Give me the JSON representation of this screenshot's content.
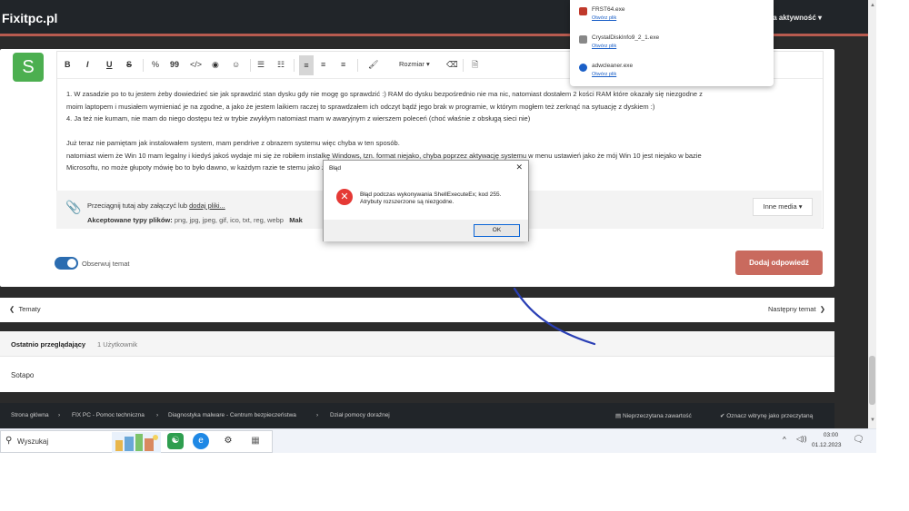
{
  "header": {
    "site_name": "Fixitpc.pl",
    "activity_link": "la aktywność ▾"
  },
  "editor": {
    "avatar_letter": "S",
    "toolbar": {
      "bold": "B",
      "italic": "I",
      "underline": "U",
      "strike": "S",
      "link": "%",
      "quote": "99",
      "code": "</>",
      "spoiler": "◉",
      "emoji": "☺",
      "bullets": "☰",
      "numbered": "☷",
      "align_left": "≡",
      "align_center": "≡",
      "align_right": "≡",
      "brush": "🖌",
      "size": "Rozmiar ▾",
      "clear": "⌫",
      "source": "🗎"
    },
    "lines": [
      "1. W zasadzie po to tu jestem żeby dowiedzieć sie jak sprawdzić stan dysku gdy nie mogę go sprawdzić :) RAM do dysku bezpośrednio nie ma nic, natomiast dostałem 2 kości RAM które okazały się niezgodne z",
      "moim laptopem i musiałem wymieniać je na zgodne, a jako że jestem laikiem raczej to sprawdzałem ich odczyt bądź jego brak w programie, w którym mogłem też zerknąć na sytuację z dyskiem :)",
      "4. Ja też nie kumam, nie mam do niego dostępu też w trybie zwykłym natomiast mam w awaryjnym z wierszem poleceń (choć właśnie z obsługą sieci nie)",
      "",
      "Już teraz nie pamiętam jak instalowałem system, mam pendrive z obrazem systemu więc chyba w ten sposób.",
      "natomiast wiem że Win 10 mam legalny i kiedyś jakoś wydaje mi się że robiłem instalkę Windows, tzn. format niejako, chyba poprzez aktywację systemu w menu ustawień jako że mój Win 10 jest niejako w bazie",
      "Microsoftu, no może głupoty mówię bo to było dawno, w każdym razie te                                                                                              stemu jako że i dysk był czysty."
    ],
    "attach_prefix": "Przeciągnij tutaj aby załączyć lub ",
    "attach_link": "dodaj pliki...",
    "accepted_label": "Akceptowane typy plików:",
    "accepted_types": " png, jpg, jpeg, gif, ico, txt, reg, webp",
    "accepted_more": "Mak",
    "media_button": "Inne media ▾",
    "watch_label": "Obserwuj temat",
    "reply_button": "Dodaj odpowiedź"
  },
  "thread_nav": {
    "prev": "Tematy",
    "next": "Następny temat"
  },
  "viewers": {
    "title": "Ostatnio przeglądający",
    "count": "1 Użytkownik",
    "user": "Sotapo"
  },
  "breadcrumbs": {
    "items": [
      "Strona główna",
      "FIX PC - Pomoc techniczna",
      "Diagnostyka malware - Centrum bezpieczeństwa",
      "Dział pomocy doraźnej"
    ],
    "unread": "▤ Nieprzeczytana zawartość",
    "mark_read": "✔ Oznacz witrynę jako przeczytaną"
  },
  "downloads": [
    {
      "name": "FRST64.exe",
      "action": "Otwórz plik",
      "color": "#c0392b"
    },
    {
      "name": "CrystalDiskInfo9_2_1.exe",
      "action": "Otwórz plik",
      "color": "#888888"
    },
    {
      "name": "adwcleaner.exe",
      "action": "Otwórz plik",
      "color": "#1a5fc7"
    }
  ],
  "dialog": {
    "title": "Błąd",
    "close": "✕",
    "line1": "Błąd podczas wykonywania ShellExecuteEx; kod 255.",
    "line2": "Atrybuty rozszerzone są niezgodne.",
    "ok": "OK"
  },
  "taskbar": {
    "search_placeholder": "Wyszukaj",
    "apps": [
      "green-app",
      "edge",
      "settings",
      "archive"
    ],
    "tray_chevron": "^",
    "volume": "◁))",
    "time": "03:00",
    "date": "01.12.2023"
  },
  "colors": {
    "accent": "#c96a5e",
    "header": "#212529",
    "toggle": "#2b6cb0",
    "avatar": "#4caf50"
  }
}
